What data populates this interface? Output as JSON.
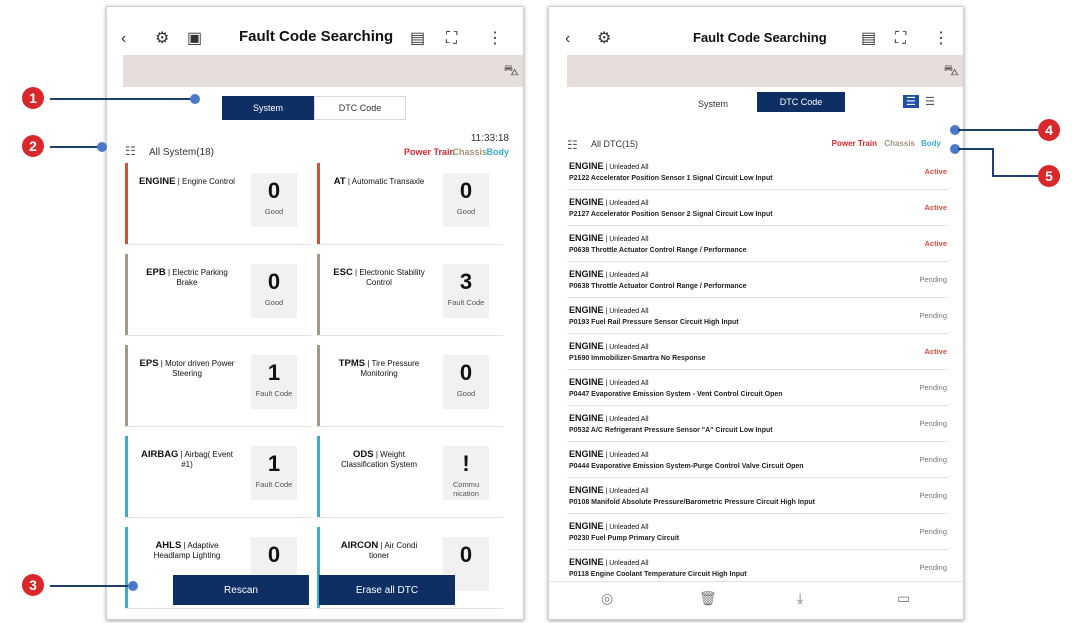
{
  "left": {
    "title": "Fault Code Searching",
    "tabs": [
      "System",
      "DTC Code"
    ],
    "count_label": "All System(18)",
    "time": "11:33:18",
    "categories": {
      "power_train": "Power Train",
      "chassis": "Chassis",
      "body": "Body"
    },
    "cards": [
      {
        "code": "ENGINE",
        "desc": "Engine Control",
        "value": "0",
        "status": "Good",
        "color": "#d4512f"
      },
      {
        "code": "AT",
        "desc": "Automatic Transaxle",
        "value": "0",
        "status": "Good",
        "color": "#d4512f"
      },
      {
        "code": "EPB",
        "desc": "Electric Parking Brake",
        "value": "0",
        "status": "Good",
        "color": "#a49a85"
      },
      {
        "code": "ESC",
        "desc": "Electronic Stability Control",
        "value": "3",
        "status": "Fault Code",
        "color": "#a49a85"
      },
      {
        "code": "EPS",
        "desc": "Motor driven Power Steering",
        "value": "1",
        "status": "Fault Code",
        "color": "#a49a85"
      },
      {
        "code": "TPMS",
        "desc": "Tire Pressure Monitoring",
        "value": "0",
        "status": "Good",
        "color": "#a49a85"
      },
      {
        "code": "AIRBAG",
        "desc": "Airbag( Event #1)",
        "value": "1",
        "status": "Fault Code",
        "color": "#3aaecb"
      },
      {
        "code": "ODS",
        "desc": "Weight Classification System",
        "value": "!",
        "status": "Commu nication",
        "color": "#3aaecb"
      },
      {
        "code": "AHLS",
        "desc": "Adaptive Headlamp Lighting",
        "value": "0",
        "status": "",
        "color": "#3aaecb"
      },
      {
        "code": "AIRCON",
        "desc": "Air Condi tioner",
        "value": "0",
        "status": "",
        "color": "#3aaecb"
      }
    ],
    "buttons": {
      "rescan": "Rescan",
      "erase": "Erase all DTC"
    }
  },
  "right": {
    "title": "Fault Code Searching",
    "tabs": [
      "System",
      "DTC Code"
    ],
    "count_label": "All DTC(15)",
    "categories": {
      "power_train": "Power Train",
      "chassis": "Chassis",
      "body": "Body"
    },
    "rows": [
      {
        "system": "ENGINE",
        "sub": "Unleaded All",
        "desc": "P2122 Accelerator Position Sensor 1 Signal Circuit Low Input",
        "status": "Active"
      },
      {
        "system": "ENGINE",
        "sub": "Unleaded All",
        "desc": "P2127 Accelerator Position Sensor 2 Signal Circuit Low Input",
        "status": "Active"
      },
      {
        "system": "ENGINE",
        "sub": "Unleaded All",
        "desc": "P0638 Throttle Actuator Control Range / Performance",
        "status": "Active"
      },
      {
        "system": "ENGINE",
        "sub": "Unleaded All",
        "desc": "P0638 Throttle Actuator Control Range / Performance",
        "status": "Pending"
      },
      {
        "system": "ENGINE",
        "sub": "Unleaded All",
        "desc": "P0193 Fuel Rail Pressure Sensor Circuit High Input",
        "status": "Pending"
      },
      {
        "system": "ENGINE",
        "sub": "Unleaded All",
        "desc": "P1690 Immobilizer-Smartra No Response",
        "status": "Active"
      },
      {
        "system": "ENGINE",
        "sub": "Unleaded All",
        "desc": "P0447 Evaporative Emission System - Vent Control Circuit Open",
        "status": "Pending"
      },
      {
        "system": "ENGINE",
        "sub": "Unleaded All",
        "desc": "P0532 A/C Refrigerant Pressure Sensor \"A\" Circuit Low Input",
        "status": "Pending"
      },
      {
        "system": "ENGINE",
        "sub": "Unleaded All",
        "desc": "P0444 Evaporative Emission System-Purge Control Valve Circuit Open",
        "status": "Pending"
      },
      {
        "system": "ENGINE",
        "sub": "Unleaded All",
        "desc": "P0108 Manifold Absolute Pressure/Barometric Pressure Circuit High Input",
        "status": "Pending"
      },
      {
        "system": "ENGINE",
        "sub": "Unleaded All",
        "desc": "P0230 Fuel Pump Primary Circuit",
        "status": "Pending"
      },
      {
        "system": "ENGINE",
        "sub": "Unleaded All",
        "desc": "P0118 Engine Coolant Temperature Circuit High Input",
        "status": "Pending"
      }
    ]
  },
  "callouts": [
    "1",
    "2",
    "3",
    "4",
    "5"
  ],
  "icons": [
    "back-icon",
    "vehicle-scan-icon",
    "add-report-icon",
    "battery-icon",
    "fullscreen-icon",
    "more-icon",
    "car-settings-icon",
    "filter-icon",
    "list-view-icon",
    "grid-view-icon",
    "stop-icon",
    "trash-icon",
    "download-icon",
    "folder-icon"
  ]
}
